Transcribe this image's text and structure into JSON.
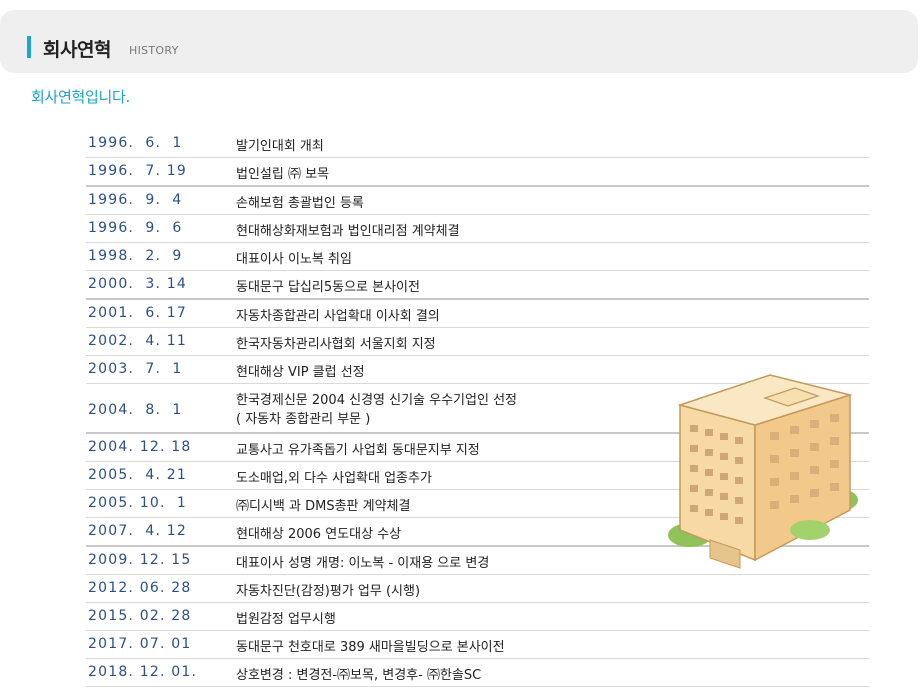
{
  "header": {
    "title": "회사연혁",
    "subtitle": "HISTORY"
  },
  "intro": "회사연혁입니다.",
  "history": [
    {
      "date": "1996.  6.  1",
      "event": "발기인대회 개최"
    },
    {
      "date": "1996.  7. 19",
      "event": "법인설립 ㈜ 보목"
    },
    {
      "date": "1996.  9.  4",
      "event": "손해보험 총괄법인 등록"
    },
    {
      "date": "1996.  9.  6",
      "event": "현대해상화재보험과 법인대리점 계약체결"
    },
    {
      "date": "1998.  2.  9",
      "event": "대표이사 이노복 취임"
    },
    {
      "date": "2000.  3. 14",
      "event": "동대문구 답십리5동으로 본사이전"
    },
    {
      "date": "2001.  6. 17",
      "event": "자동차종합관리 사업확대 이사회 결의"
    },
    {
      "date": "2002.  4. 11",
      "event": "한국자동차관리사협회 서울지회 지정"
    },
    {
      "date": "2003.  7.  1",
      "event": "현대해상 VIP 클럽 선정"
    },
    {
      "date": "2004.  8.  1",
      "event": "한국경제신문 2004 신경영 신기술 우수기업인 선정",
      "event2": "( 자동차 종합관리 부문 )"
    },
    {
      "date": "2004. 12. 18",
      "event": "교통사고 유가족돕기 사업회 동대문지부 지정"
    },
    {
      "date": "2005.  4. 21",
      "event": "도소매업,외 다수 사업확대 업종추가"
    },
    {
      "date": "2005. 10.  1",
      "event": "㈜디시백 과 DMS총판 계약체결"
    },
    {
      "date": "2007.  4. 12",
      "event": "현대해상 2006 연도대상 수상"
    },
    {
      "date": "2009. 12. 15",
      "event": "대표이사 성명 개명: 이노복 - 이재용 으로 변경"
    },
    {
      "date": "2012. 06. 28",
      "event": "자동차진단(감정)평가 업무 (시행)"
    },
    {
      "date": "2015. 02. 28",
      "event": "법원감정 업무시행"
    },
    {
      "date": "2017. 07. 01",
      "event": "동대문구 천호대로 389 새마을빌딩으로 본사이전"
    },
    {
      "date": "2018. 12. 01.",
      "event": "상호변경 : 변경전-㈜보목, 변경후- ㈜한솔SC"
    }
  ],
  "colors": {
    "accent": "#1aa7d8",
    "date": "#2b4f86",
    "intro": "#1aa3c7"
  },
  "illustration": "building-illustration"
}
